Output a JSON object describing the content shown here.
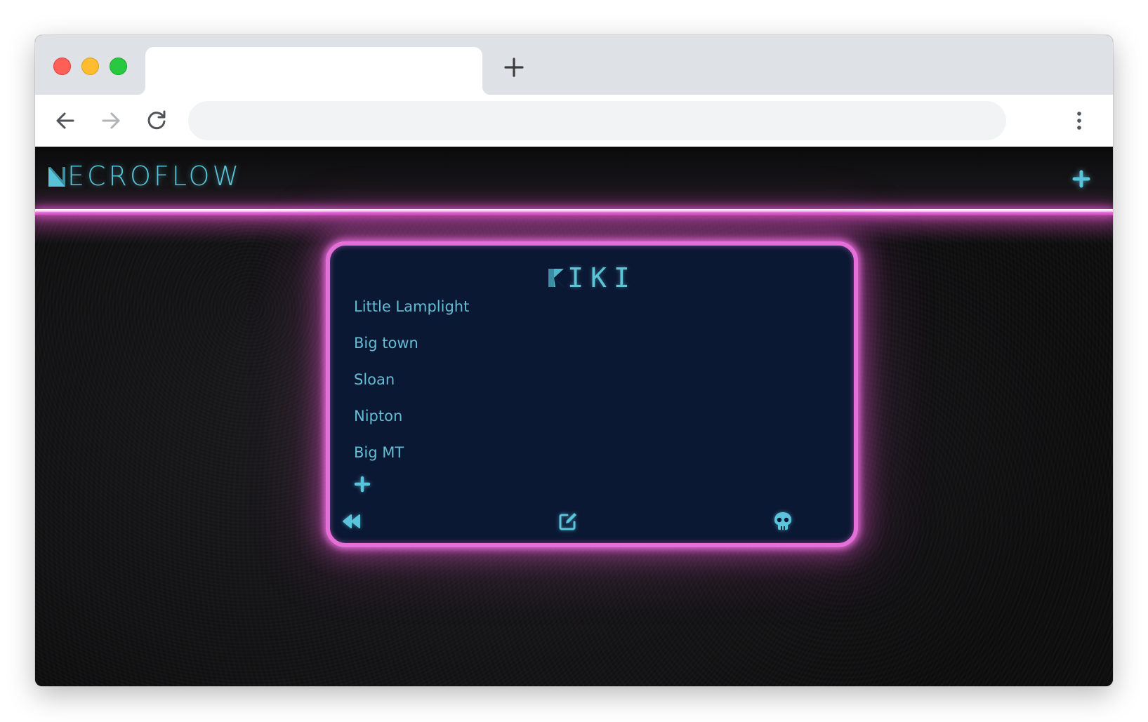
{
  "browser": {
    "address_value": "",
    "address_placeholder": ""
  },
  "app": {
    "logo_text": "ECROFLOW",
    "accent_cyan": "#59c2d6",
    "accent_pink": "#e56fd8",
    "card_background": "#0b1833"
  },
  "card": {
    "title": "IKI",
    "locations": [
      {
        "label": "Little Lamplight"
      },
      {
        "label": "Big town"
      },
      {
        "label": "Sloan"
      },
      {
        "label": "Nipton"
      },
      {
        "label": "Big MT"
      }
    ],
    "icons": {
      "add": "plus-icon",
      "back": "rewind-icon",
      "edit": "edit-icon",
      "delete": "skull-icon"
    }
  }
}
